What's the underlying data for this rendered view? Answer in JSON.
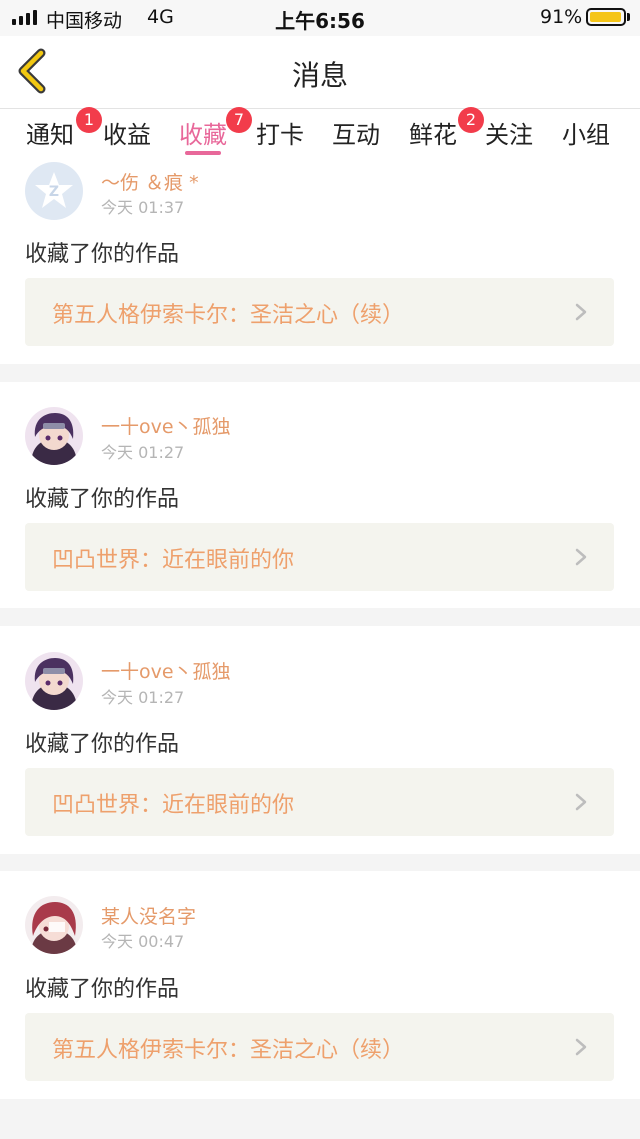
{
  "status_bar": {
    "carrier": "中国移动",
    "network": "4G",
    "time": "上午6:56",
    "battery": "91%",
    "battery_level": 0.91
  },
  "header": {
    "title": "消息",
    "back_icon": "chevron-left-icon"
  },
  "tabs": [
    {
      "label": "通知",
      "badge": "1"
    },
    {
      "label": "收益"
    },
    {
      "label": "收藏",
      "badge": "7",
      "active": true
    },
    {
      "label": "打卡"
    },
    {
      "label": "互动"
    },
    {
      "label": "鲜花",
      "badge": "2"
    },
    {
      "label": "关注"
    },
    {
      "label": "小组"
    }
  ],
  "feed": [
    {
      "user": "～伤 ＆痕 *",
      "time": "今天 01:37",
      "action": "收藏了你的作品",
      "work": "第五人格伊索卡尔：圣洁之心（续）",
      "avatar": "default-avatar"
    },
    {
      "user": "一十ove丶孤独",
      "time": "今天 01:27",
      "action": "收藏了你的作品",
      "work": "凹凸世界：近在眼前的你",
      "avatar": "anime-avatar"
    },
    {
      "user": "一十ove丶孤独",
      "time": "今天 01:27",
      "action": "收藏了你的作品",
      "work": "凹凸世界：近在眼前的你",
      "avatar": "anime-avatar"
    },
    {
      "user": "某人没名字",
      "time": "今天 00:47",
      "action": "收藏了你的作品",
      "work": "第五人格伊索卡尔：圣洁之心（续）",
      "avatar": "anime-avatar-red-hair"
    }
  ],
  "colors": {
    "accent": "#e8689a",
    "badge": "#f23c4b",
    "username": "#e59a6a",
    "work_title": "#eea06c",
    "back_icon": "#f2c811"
  }
}
